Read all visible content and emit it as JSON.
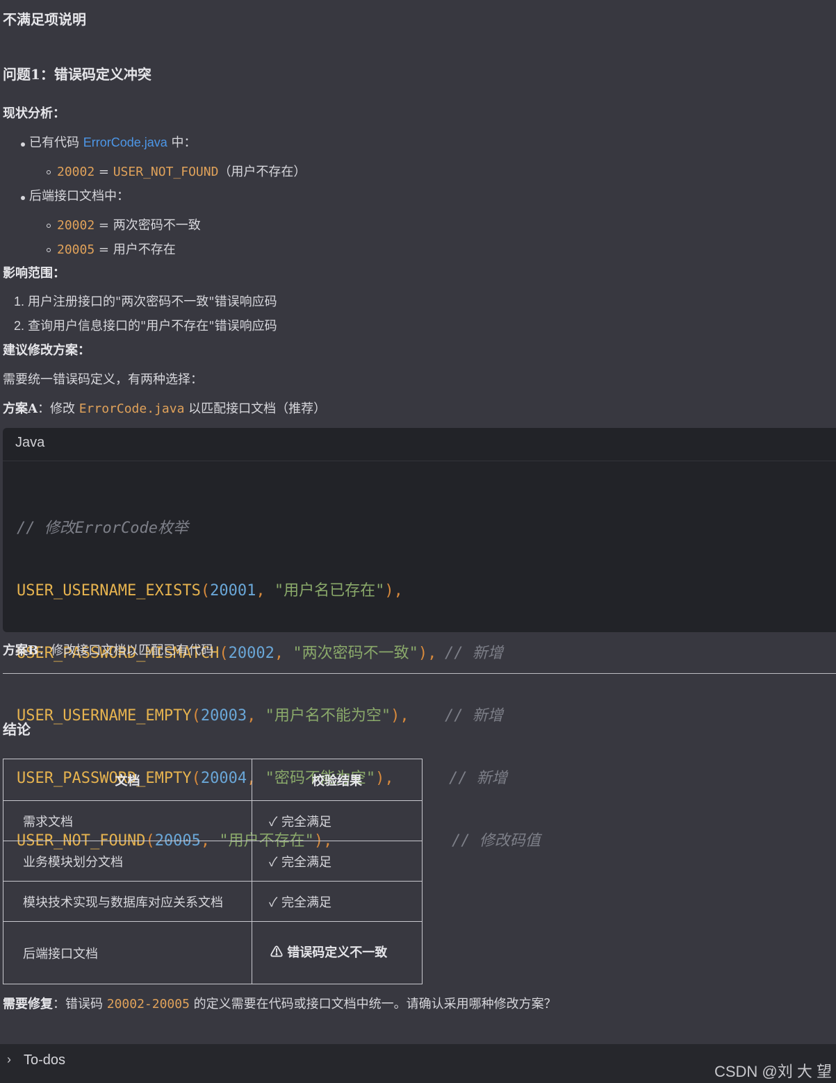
{
  "title": "不满足项说明",
  "issue_title": "问题1：错误码定义冲突",
  "status_heading": "现状分析：",
  "existing_code_prefix": "已有代码 ",
  "existing_code_file": "ErrorCode.java",
  "existing_code_suffix": " 中：",
  "code_items": [
    {
      "code": "20002",
      "eq": " = ",
      "name": "USER_NOT_FOUND",
      "desc": "（用户不存在）"
    }
  ],
  "doc_label": "后端接口文档中：",
  "doc_items": [
    {
      "code": "20002",
      "eq": " = ",
      "desc": "两次密码不一致"
    },
    {
      "code": "20005",
      "eq": " = ",
      "desc": "用户不存在"
    }
  ],
  "impact_heading": "影响范围：",
  "impact_items": [
    "用户注册接口的\"两次密码不一致\"错误响应码",
    "查询用户信息接口的\"用户不存在\"错误响应码"
  ],
  "suggest_heading": "建议修改方案：",
  "suggest_text": "需要统一错误码定义，有两种选择：",
  "planA_label": "方案A",
  "planA_colon": "：修改 ",
  "planA_file": "ErrorCode.java",
  "planA_suffix": " 以匹配接口文档（推荐）",
  "code_lang": "Java",
  "code_comment": "// 修改ErrorCode枚举",
  "code_rows": [
    {
      "name": "USER_USERNAME_EXISTS",
      "num": "20001",
      "str": "\"用户名已存在\"",
      "comment": ""
    },
    {
      "name": "USER_PASSWORD_MISMATCH",
      "num": "20002",
      "str": "\"两次密码不一致\"",
      "comment": "// 新增"
    },
    {
      "name": "USER_USERNAME_EMPTY",
      "num": "20003",
      "str": "\"用户名不能为空\"",
      "comment": "// 新增"
    },
    {
      "name": "USER_PASSWORD_EMPTY",
      "num": "20004",
      "str": "\"密码不能为空\"",
      "comment": "// 新增"
    },
    {
      "name": "USER_NOT_FOUND",
      "num": "20005",
      "str": "\"用户不存在\"",
      "comment": "// 修改码值"
    }
  ],
  "planB_label": "方案B",
  "planB_text": "：修改接口文档以匹配已有代码",
  "conclusion": "结论",
  "table": {
    "headers": [
      "文档",
      "校验结果"
    ],
    "rows": [
      {
        "doc": "需求文档",
        "result": "✓ 完全满足"
      },
      {
        "doc": "业务模块划分文档",
        "result": "✓ 完全满足"
      },
      {
        "doc": "模块技术实现与数据库对应关系文档",
        "result": "✓ 完全满足"
      },
      {
        "doc": "后端接口文档",
        "result": "⚠ 错误码定义不一致"
      }
    ]
  },
  "fix_label": "需要修复",
  "fix_prefix": "：错误码 ",
  "fix_codes": "20002-20005",
  "fix_suffix": " 的定义需要在代码或接口文档中统一。请确认采用哪种修改方案？",
  "todo_label": "To-dos",
  "watermark": "CSDN @刘 大 望",
  "colors": {
    "accent_orange": "#e0a25a",
    "link_blue": "#4d97e8",
    "background": "#383840",
    "code_bg": "#222328",
    "warning": "#f0b429"
  }
}
